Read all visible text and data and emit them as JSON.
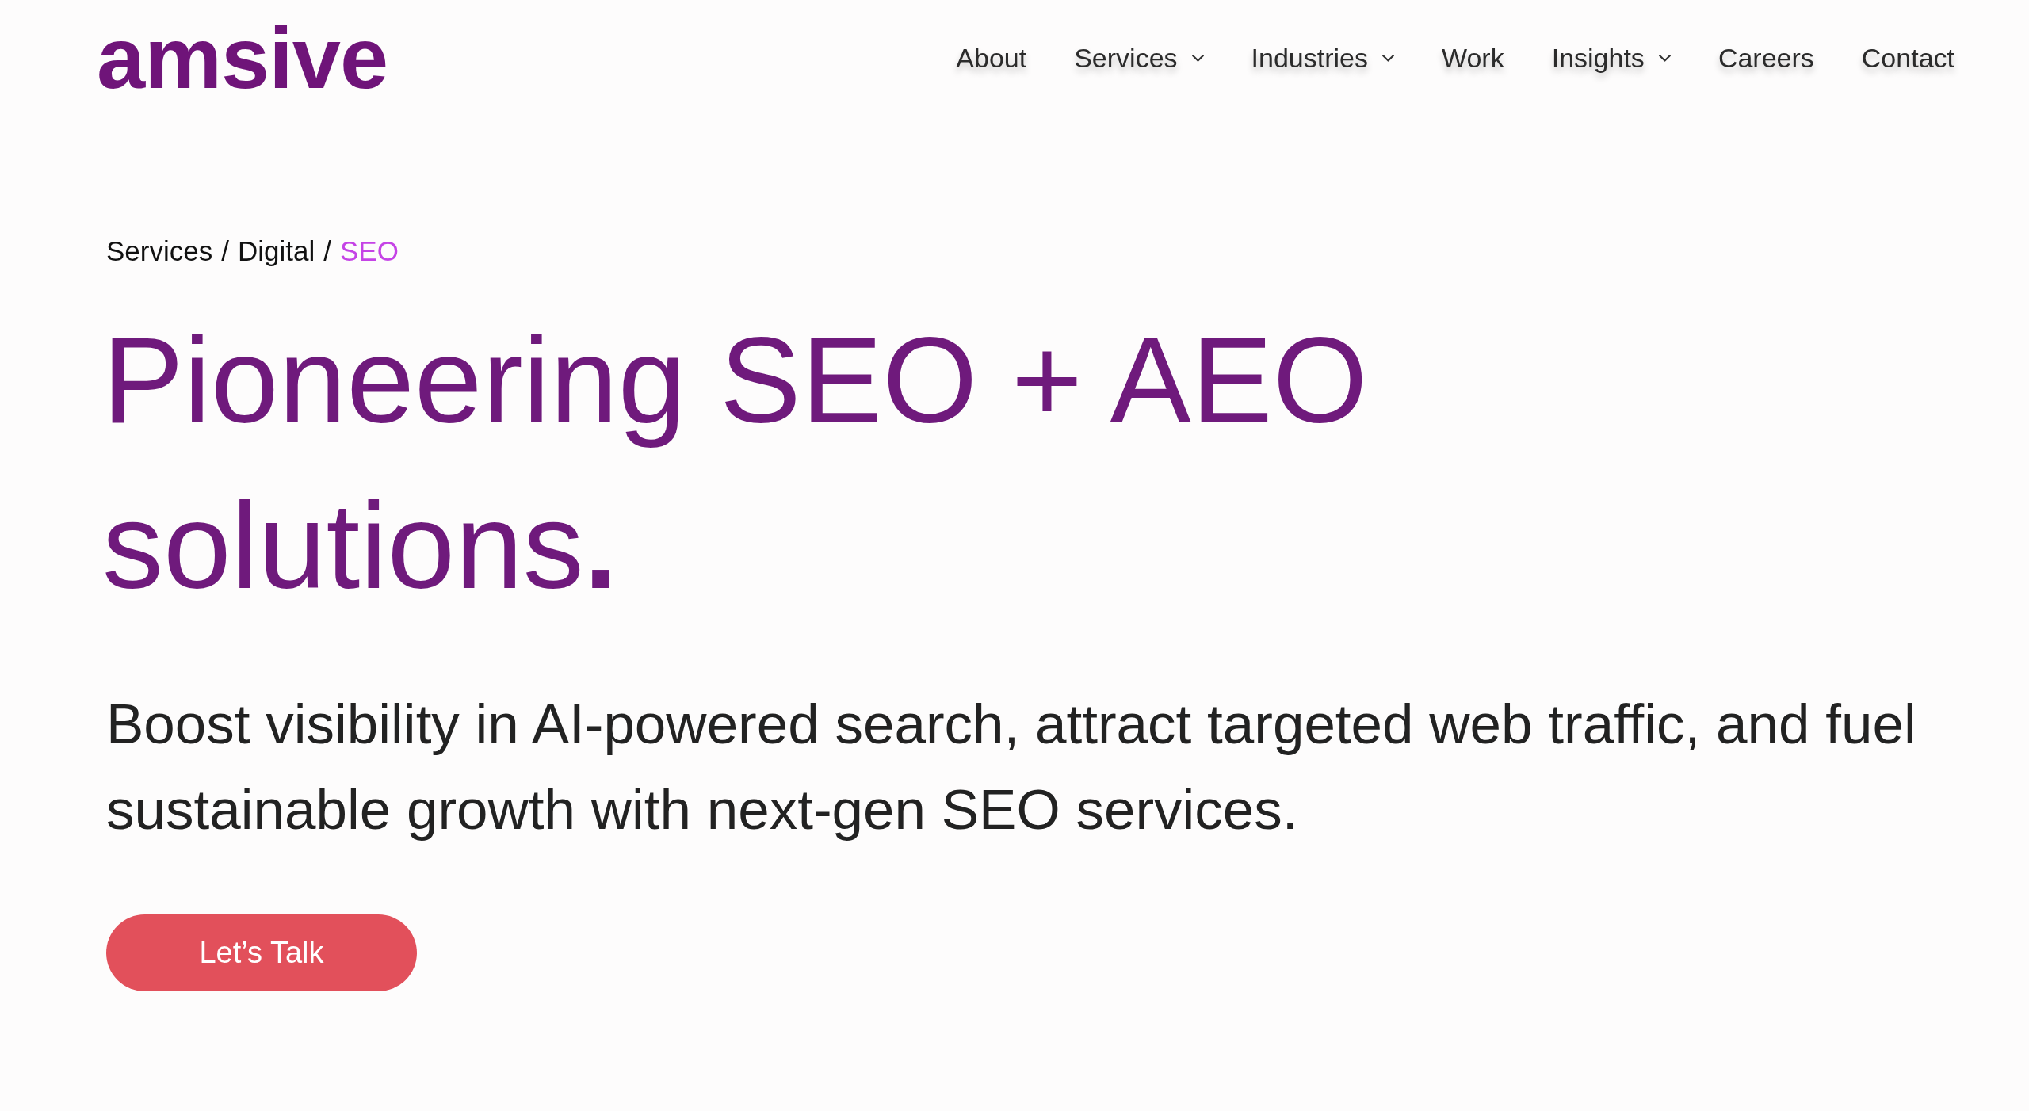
{
  "header": {
    "logo": "amsive",
    "nav": [
      {
        "label": "About",
        "has_dropdown": false
      },
      {
        "label": "Services",
        "has_dropdown": true
      },
      {
        "label": "Industries",
        "has_dropdown": true
      },
      {
        "label": "Work",
        "has_dropdown": false
      },
      {
        "label": "Insights",
        "has_dropdown": true
      },
      {
        "label": "Careers",
        "has_dropdown": false
      },
      {
        "label": "Contact",
        "has_dropdown": false
      }
    ]
  },
  "hero": {
    "breadcrumb": [
      {
        "label": "Services",
        "current": false,
        "separator": "/"
      },
      {
        "label": "Digital",
        "current": false,
        "separator": "/"
      },
      {
        "label": "SEO",
        "current": true
      }
    ],
    "headline": "Pioneering SEO + AEO solutions**.**",
    "description": "Boost visibility in AI-powered search, attract targeted web traffic, and fuel sustainable growth with next-gen SEO services.",
    "cta": "Let’s Talk"
  }
}
